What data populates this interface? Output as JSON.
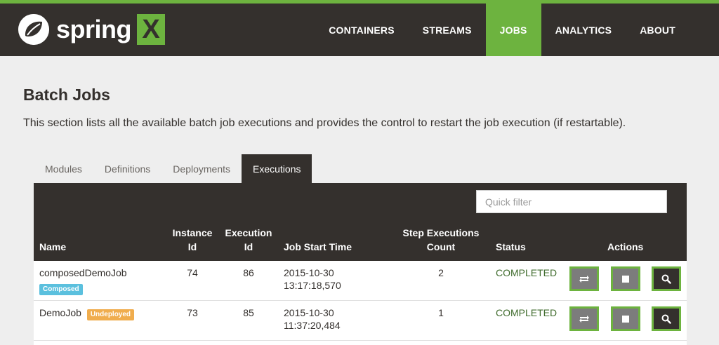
{
  "brand": {
    "name": "spring",
    "mark": "X"
  },
  "nav": {
    "items": [
      {
        "label": "CONTAINERS"
      },
      {
        "label": "STREAMS"
      },
      {
        "label": "JOBS",
        "active": true
      },
      {
        "label": "ANALYTICS"
      },
      {
        "label": "ABOUT"
      }
    ]
  },
  "page": {
    "title": "Batch Jobs",
    "description": "This section lists all the available batch job executions and provides the control to restart the job execution (if restartable)."
  },
  "tabs": [
    {
      "label": "Modules"
    },
    {
      "label": "Definitions"
    },
    {
      "label": "Deployments"
    },
    {
      "label": "Executions",
      "active": true
    }
  ],
  "filter": {
    "placeholder": "Quick filter",
    "value": ""
  },
  "table": {
    "headers": {
      "name": "Name",
      "instance_id_line1": "Instance",
      "instance_id_line2": "Id",
      "execution_id_line1": "Execution",
      "execution_id_line2": "Id",
      "job_start_time": "Job Start Time",
      "step_count_line1": "Step Executions",
      "step_count_line2": "Count",
      "status": "Status",
      "actions": "Actions"
    },
    "rows": [
      {
        "name": "composedDemoJob",
        "badge": "Composed",
        "instance_id": "74",
        "execution_id": "86",
        "start_date": "2015-10-30",
        "start_time": "13:17:18,570",
        "step_count": "2",
        "status": "COMPLETED"
      },
      {
        "name": "DemoJob",
        "badge": "Undeployed",
        "instance_id": "73",
        "execution_id": "85",
        "start_date": "2015-10-30",
        "start_time": "11:37:20,484",
        "step_count": "1",
        "status": "COMPLETED"
      }
    ]
  },
  "colors": {
    "brand_green": "#6db33f",
    "header_dark": "#34302d",
    "status_completed": "#3f6b2c",
    "badge_composed": "#5bc0de",
    "badge_undeployed": "#f0ad4e"
  },
  "icons": {
    "restart": "restart-icon",
    "stop": "stop-icon",
    "details": "search-icon"
  }
}
